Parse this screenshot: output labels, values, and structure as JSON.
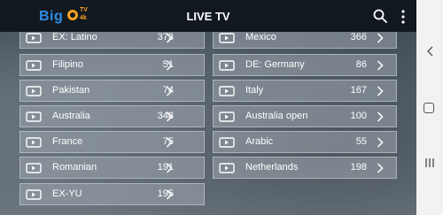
{
  "app": {
    "logo_text": "Big",
    "logo_badge_top": "TV",
    "logo_badge_bottom": "4k",
    "title": "LIVE TV"
  },
  "icons": {
    "search": "search-icon",
    "menu": "more-vertical-icon",
    "channel": "tv-icon",
    "chevron": "chevron-right-icon"
  },
  "colors": {
    "topbar": "#121820",
    "accent_blue": "#2f8de4",
    "accent_orange": "#f3a21e"
  },
  "left_column": [
    {
      "name": "EX: Latino",
      "count": "373"
    },
    {
      "name": "Filipino",
      "count": "51"
    },
    {
      "name": "Pakistan",
      "count": "74"
    },
    {
      "name": "Australia",
      "count": "348"
    },
    {
      "name": "France",
      "count": "75"
    },
    {
      "name": "Romanian",
      "count": "191"
    },
    {
      "name": "EX-YU",
      "count": "195"
    }
  ],
  "right_column": [
    {
      "name": "Mexico",
      "count": "366"
    },
    {
      "name": "DE: Germany",
      "count": "86"
    },
    {
      "name": "Italy",
      "count": "167"
    },
    {
      "name": "Australia open",
      "count": "100"
    },
    {
      "name": "Arabic",
      "count": "55"
    },
    {
      "name": "Netherlands",
      "count": "198"
    }
  ]
}
